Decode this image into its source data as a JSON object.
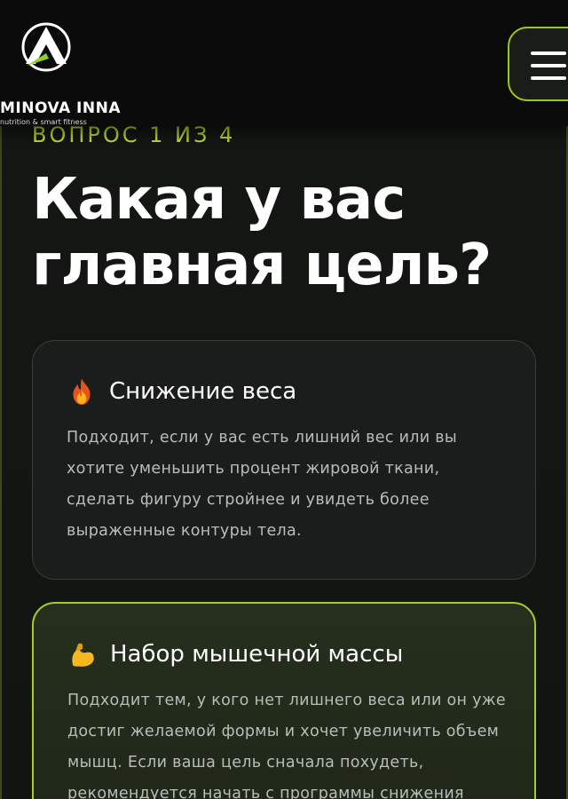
{
  "header": {
    "logo": {
      "title": "MINOVA INNA",
      "subtitle": "nutrition & smart fitness"
    },
    "menu_icon": "hamburger-menu-icon",
    "accent_color": "#9bc81e"
  },
  "quiz": {
    "step_label": "ВОПРОС 1 ИЗ 4",
    "question": "Какая у вас главная цель?",
    "options": [
      {
        "icon": "fire-icon",
        "title": "Снижение веса",
        "description": "Подходит, если у вас есть лишний вес или вы хотите уменьшить процент жировой ткани, сделать фигуру стройнее и увидеть более выраженные контуры тела.",
        "selected": false
      },
      {
        "icon": "flexed-bicep-icon",
        "title": "Набор мышечной массы",
        "description": "Подходит тем, у кого нет лишнего веса или он уже достиг желаемой формы и хочет увеличить объем мышц. Если ваша цель сначала похудеть, рекомендуется начать с программы снижения",
        "selected": true
      }
    ]
  }
}
